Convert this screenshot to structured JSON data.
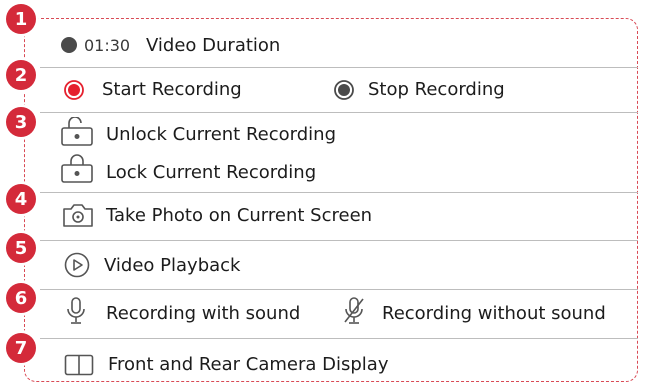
{
  "badges": [
    "1",
    "2",
    "3",
    "4",
    "5",
    "6",
    "7"
  ],
  "duration": {
    "time": "01:30",
    "label": "Video Duration"
  },
  "recording": {
    "start_label": "Start Recording",
    "stop_label": "Stop Recording"
  },
  "lock": {
    "unlock_label": "Unlock Current Recording",
    "lock_label": "Lock Current Recording"
  },
  "photo": {
    "label": "Take Photo on Current Screen"
  },
  "playback": {
    "label": "Video Playback"
  },
  "sound": {
    "with_label": "Recording with sound",
    "without_label": "Recording without sound"
  },
  "camera": {
    "label": "Front and Rear Camera Display"
  },
  "colors": {
    "accent": "#d42a3a",
    "record_red": "#e5202e",
    "icon_gray": "#555555",
    "dash": "#d94a55"
  }
}
